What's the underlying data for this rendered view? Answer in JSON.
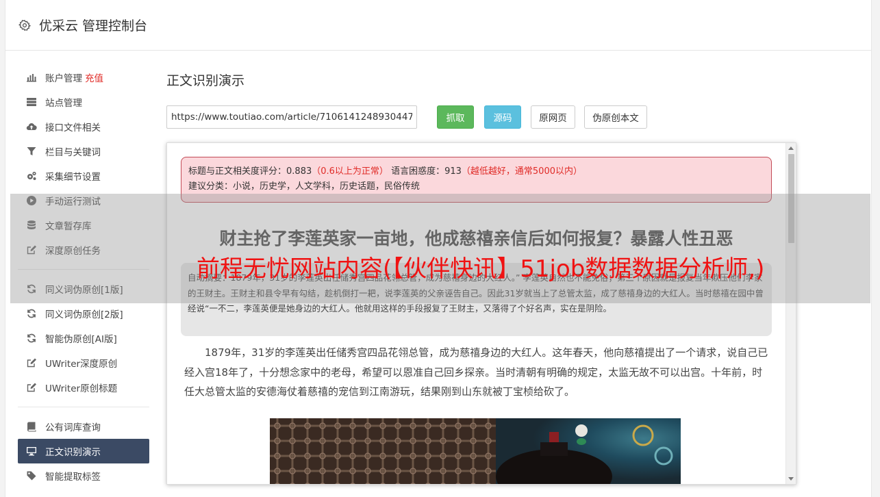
{
  "app": {
    "title": "优采云 管理控制台"
  },
  "sidebar": {
    "group1": [
      {
        "label": "账户管理",
        "badge": "充值",
        "icon": "bar-chart-icon"
      },
      {
        "label": "站点管理",
        "icon": "server-icon"
      },
      {
        "label": "接口文件相关",
        "icon": "cloud-upload-icon"
      },
      {
        "label": "栏目与关键词",
        "icon": "filter-icon"
      },
      {
        "label": "采集细节设置",
        "icon": "cogs-icon"
      },
      {
        "label": "手动运行测试",
        "icon": "play-circle-icon"
      },
      {
        "label": "文章暂存库",
        "icon": "database-icon"
      },
      {
        "label": "深度原创任务",
        "icon": "edit-icon"
      }
    ],
    "group2": [
      {
        "label": "同义词伪原创[1版]",
        "icon": "refresh-icon"
      },
      {
        "label": "同义词伪原创[2版]",
        "icon": "refresh-icon"
      },
      {
        "label": "智能伪原创[AI版]",
        "icon": "refresh-icon"
      },
      {
        "label": "UWriter深度原创",
        "icon": "edit-icon"
      },
      {
        "label": "UWriter原创标题",
        "icon": "edit-icon"
      }
    ],
    "group3": [
      {
        "label": "公有词库查询",
        "icon": "book-icon"
      },
      {
        "label": "正文识别演示",
        "icon": "monitor-icon",
        "active": true
      },
      {
        "label": "智能提取标签",
        "icon": "tag-icon"
      }
    ]
  },
  "main": {
    "page_title": "正文识别演示",
    "url_value": "https://www.toutiao.com/article/7106141248930447",
    "buttons": {
      "fetch": "抓取",
      "source": "源码",
      "original": "原网页",
      "fake_original": "伪原创本文"
    }
  },
  "result": {
    "score_label": "标题与正文相关度评分：",
    "score_value": "0.883",
    "score_note": "（0.6以上为正常）",
    "perplexity_label": "语言困惑度：",
    "perplexity_value": "913",
    "perplexity_note": "（越低越好，通常5000以内）",
    "category_label": "建议分类：",
    "category_value": "小说，历史学，人文学科，历史话题，民俗传统",
    "article_title": "财主抢了李莲英家一亩地，他成慈禧亲信后如何报复？暴露人性丑恶",
    "summary": "自动摘要：1879年，31岁的李莲英出任储秀宫四品花翎总管，成为慈禧身边的大红人。” 李莲英自然也不能免俗；第三个原因就是报复当年欺压他们李家的王财主。王财主和县令早有勾结，趁机倒打一耙，说李莲英的父亲诬告自己。因此31岁就当上了总管太监，成了慈禧身边的大红人。当时慈禧在园中曾经说“一不二，李莲英便是她身边的大红人。他就用这样的手段报复了王财主，又落得了个好名声，实在是阴险。",
    "paragraph": "1879年，31岁的李莲英出任储秀宫四品花翎总管，成为慈禧身边的大红人。这年春天，他向慈禧提出了一个请求，说自己已经入宫18年了，十分想念家中的老母，希望可以恩准自己回乡探亲。当时清朝有明确的规定，太监无故不可以出宫。十年前，时任大总管太监的安德海仗着慈禧的宠信到江南游玩，结果刚到山东就被丁宝桢给砍了。"
  },
  "watermark": "前程无忧网站内容(【伙伴快讯】51job数据数据分析师,)"
}
